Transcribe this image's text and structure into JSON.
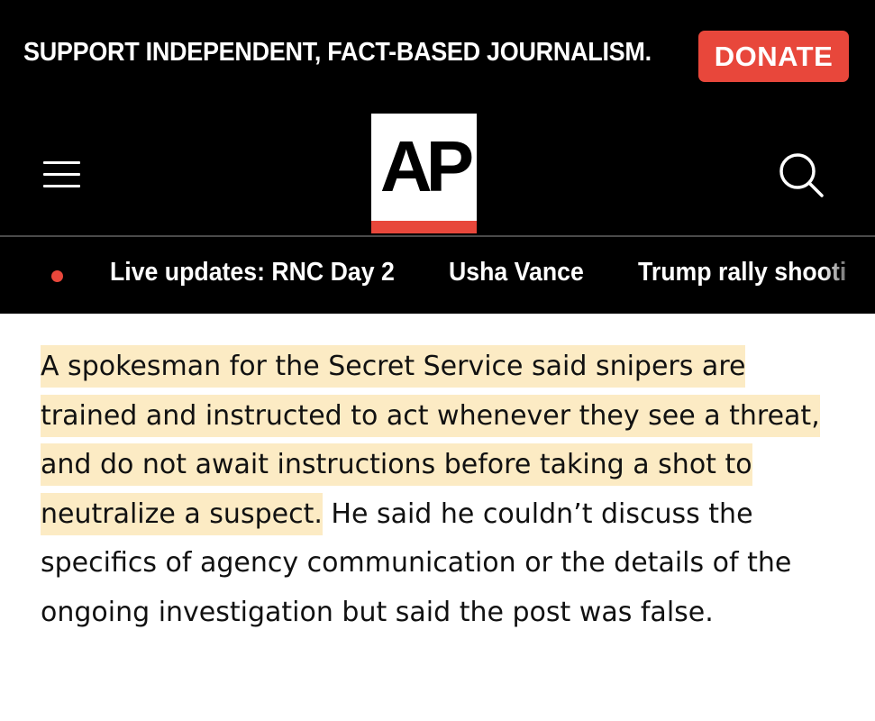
{
  "support_banner": {
    "text": "SUPPORT INDEPENDENT, FACT-BASED JOURNALISM.",
    "donate_label": "DONATE"
  },
  "header": {
    "logo_text": "AP",
    "menu_icon": "hamburger-menu-icon",
    "search_icon": "search-icon"
  },
  "trending": {
    "live_indicator": "live-dot",
    "items": [
      {
        "label": "Live updates: RNC Day 2"
      },
      {
        "label": "Usha Vance"
      },
      {
        "label": "Trump rally shooti"
      }
    ]
  },
  "article": {
    "highlighted_text": "A spokesman for the Secret Service said snipers are trained and instructed to act whenever they see a threat, and do not await instructions before taking a shot to neutralize a suspect.",
    "rest_text": " He said he couldn’t discuss the specifics of agency communication or the details of the ongoing investigation but said the post was false."
  },
  "colors": {
    "background": "#000000",
    "accent_red": "#e8473b",
    "highlight": "#fcebc4",
    "text": "#111111"
  }
}
